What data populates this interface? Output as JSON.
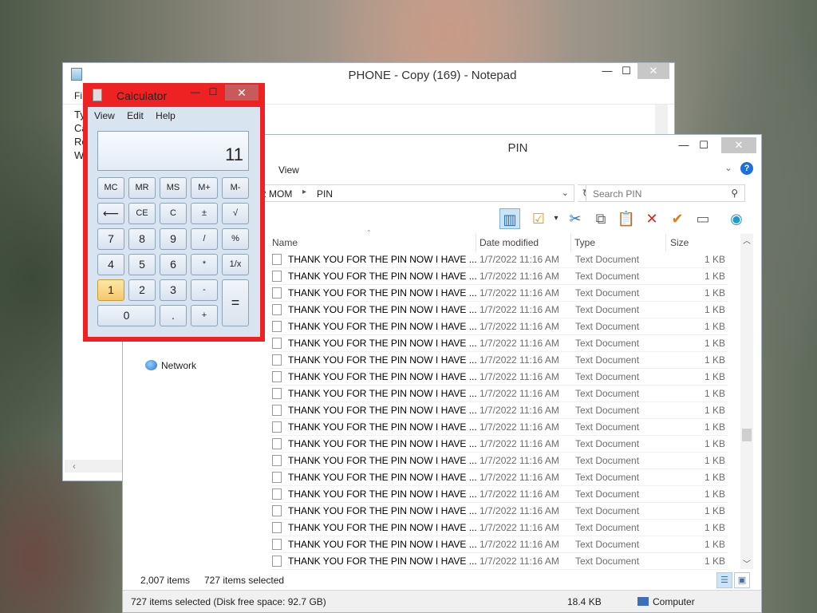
{
  "notepad": {
    "title": "PHONE - Copy (169) - Notepad",
    "menu_visible": "Fi",
    "text_lines": [
      "Ty",
      "Ca",
      "Re",
      "WE"
    ],
    "controls": {
      "min": "—",
      "max": "☐",
      "close": "✕"
    }
  },
  "explorer": {
    "title": "PIN",
    "ribbon_tab": "View",
    "breadcrumb": [
      "R MOM",
      "PIN"
    ],
    "breadcrumb_sep": "▸",
    "search_placeholder": "Search PIN",
    "controls": {
      "min": "—",
      "max": "☐",
      "close": "✕"
    },
    "columns": {
      "name": "Name",
      "date": "Date modified",
      "type": "Type",
      "size": "Size"
    },
    "rows": [
      {
        "name": "THANK YOU FOR THE PIN NOW I HAVE ...",
        "date": "1/7/2022 11:16 AM",
        "type": "Text Document",
        "size": "1 KB"
      },
      {
        "name": "THANK YOU FOR THE PIN NOW I HAVE ...",
        "date": "1/7/2022 11:16 AM",
        "type": "Text Document",
        "size": "1 KB"
      },
      {
        "name": "THANK YOU FOR THE PIN NOW I HAVE ...",
        "date": "1/7/2022 11:16 AM",
        "type": "Text Document",
        "size": "1 KB"
      },
      {
        "name": "THANK YOU FOR THE PIN NOW I HAVE ...",
        "date": "1/7/2022 11:16 AM",
        "type": "Text Document",
        "size": "1 KB"
      },
      {
        "name": "THANK YOU FOR THE PIN NOW I HAVE ...",
        "date": "1/7/2022 11:16 AM",
        "type": "Text Document",
        "size": "1 KB"
      },
      {
        "name": "THANK YOU FOR THE PIN NOW I HAVE ...",
        "date": "1/7/2022 11:16 AM",
        "type": "Text Document",
        "size": "1 KB"
      },
      {
        "name": "THANK YOU FOR THE PIN NOW I HAVE ...",
        "date": "1/7/2022 11:16 AM",
        "type": "Text Document",
        "size": "1 KB"
      },
      {
        "name": "THANK YOU FOR THE PIN NOW I HAVE ...",
        "date": "1/7/2022 11:16 AM",
        "type": "Text Document",
        "size": "1 KB"
      },
      {
        "name": "THANK YOU FOR THE PIN NOW I HAVE ...",
        "date": "1/7/2022 11:16 AM",
        "type": "Text Document",
        "size": "1 KB"
      },
      {
        "name": "THANK YOU FOR THE PIN NOW I HAVE ...",
        "date": "1/7/2022 11:16 AM",
        "type": "Text Document",
        "size": "1 KB"
      },
      {
        "name": "THANK YOU FOR THE PIN NOW I HAVE ...",
        "date": "1/7/2022 11:16 AM",
        "type": "Text Document",
        "size": "1 KB"
      },
      {
        "name": "THANK YOU FOR THE PIN NOW I HAVE ...",
        "date": "1/7/2022 11:16 AM",
        "type": "Text Document",
        "size": "1 KB"
      },
      {
        "name": "THANK YOU FOR THE PIN NOW I HAVE ...",
        "date": "1/7/2022 11:16 AM",
        "type": "Text Document",
        "size": "1 KB"
      },
      {
        "name": "THANK YOU FOR THE PIN NOW I HAVE ...",
        "date": "1/7/2022 11:16 AM",
        "type": "Text Document",
        "size": "1 KB"
      },
      {
        "name": "THANK YOU FOR THE PIN NOW I HAVE ...",
        "date": "1/7/2022 11:16 AM",
        "type": "Text Document",
        "size": "1 KB"
      },
      {
        "name": "THANK YOU FOR THE PIN NOW I HAVE ...",
        "date": "1/7/2022 11:16 AM",
        "type": "Text Document",
        "size": "1 KB"
      },
      {
        "name": "THANK YOU FOR THE PIN NOW I HAVE ...",
        "date": "1/7/2022 11:16 AM",
        "type": "Text Document",
        "size": "1 KB"
      },
      {
        "name": "THANK YOU FOR THE PIN NOW I HAVE ...",
        "date": "1/7/2022 11:16 AM",
        "type": "Text Document",
        "size": "1 KB"
      },
      {
        "name": "THANK YOU FOR THE PIN NOW I HAVE ...",
        "date": "1/7/2022 11:16 AM",
        "type": "Text Document",
        "size": "1 KB"
      }
    ],
    "nav": {
      "network": "Network"
    },
    "status": {
      "item_count": "2,007 items",
      "selected": "727 items selected",
      "bottom_left": "727 items selected (Disk free space: 92.7 GB)",
      "bottom_size": "18.4 KB",
      "bottom_location": "Computer"
    }
  },
  "calculator": {
    "title": "Calculator",
    "menu": [
      "View",
      "Edit",
      "Help"
    ],
    "display": "11",
    "pressed_key": "1",
    "controls": {
      "min": "—",
      "max": "☐",
      "close": "✕"
    },
    "keys": {
      "mc": "MC",
      "mr": "MR",
      "ms": "MS",
      "mplus": "M+",
      "mminus": "M-",
      "back": "⟵",
      "ce": "CE",
      "c": "C",
      "plusminus": "±",
      "sqrt": "√",
      "k7": "7",
      "k8": "8",
      "k9": "9",
      "div": "/",
      "pct": "%",
      "k4": "4",
      "k5": "5",
      "k6": "6",
      "mul": "*",
      "recip": "1/x",
      "k1": "1",
      "k2": "2",
      "k3": "3",
      "sub": "-",
      "eq": "=",
      "k0": "0",
      "dot": ".",
      "add": "+"
    }
  },
  "colors": {
    "calc_highlight": "#e22222",
    "selection_blue": "#cce4f7"
  }
}
